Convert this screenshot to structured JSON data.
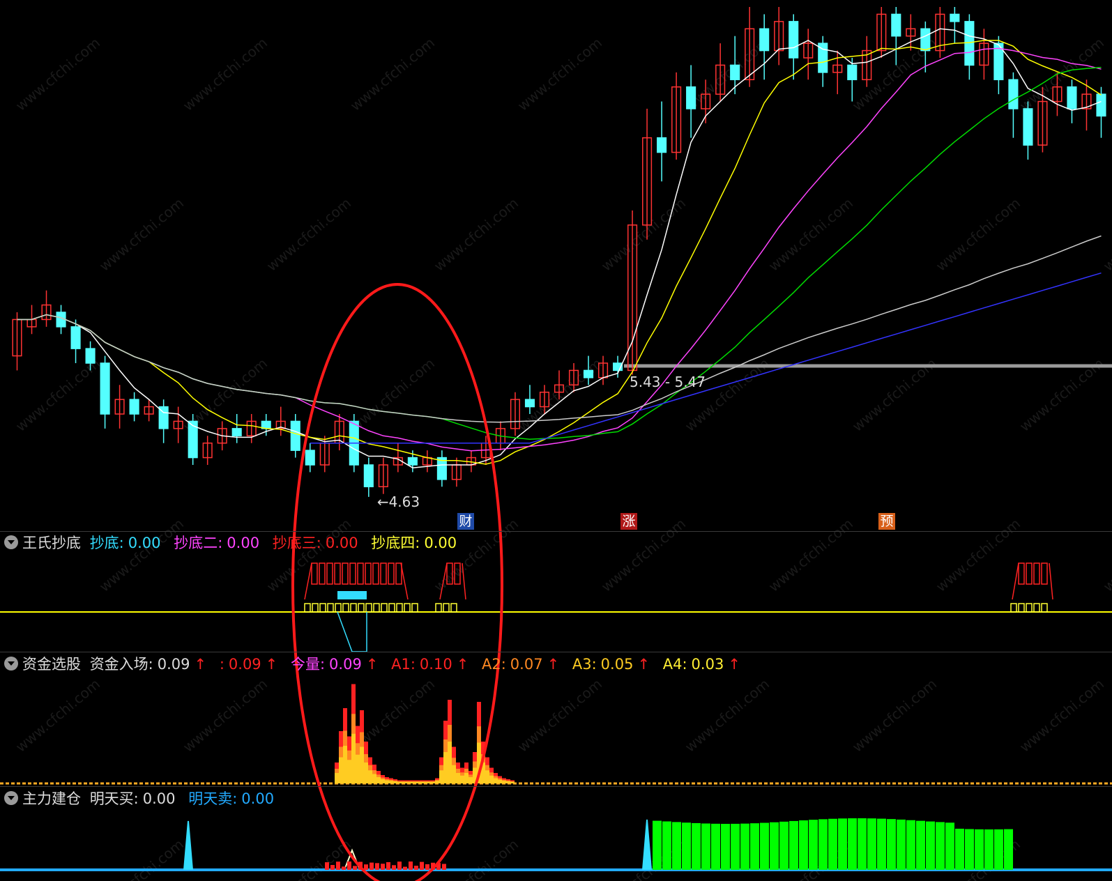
{
  "colors": {
    "background": "#000000",
    "up_candle": "#ff3333",
    "down_candle": "#54ffff",
    "ma5": "#ffffff",
    "ma10": "#ffff00",
    "ma20": "#ff44ff",
    "ma30": "#00dd00",
    "ma60": "#cccccc",
    "ma120": "#3333ff",
    "highlight_ellipse": "#ff1a1a",
    "baseline": "#ffff00",
    "tomorrow_buy": "#00ff00",
    "tomorrow_sell": "#22aaff"
  },
  "watermark": "www.cfchi.com",
  "main_panel": {
    "low_label": "4.63",
    "range_label": "5.43 - 5.47",
    "markers": [
      {
        "text": "财",
        "color": "#1f4aa8"
      },
      {
        "text": "涨",
        "color": "#b01818"
      },
      {
        "text": "预",
        "color": "#d8601a"
      }
    ]
  },
  "panels": {
    "chaodi": {
      "name": "王氏抄底",
      "items": [
        {
          "label": "抄底:",
          "value": "0.00",
          "color": "#33ddff"
        },
        {
          "label": "抄底二:",
          "value": "0.00",
          "color": "#ff44ff"
        },
        {
          "label": "抄底三:",
          "value": "0.00",
          "color": "#ff2222"
        },
        {
          "label": "抄底四:",
          "value": "0.00",
          "color": "#ffff33"
        }
      ]
    },
    "zijin": {
      "name": "资金选股",
      "items": [
        {
          "label": "资金入场:",
          "value": "0.09",
          "arrow": "↑",
          "color": "#dddddd"
        },
        {
          "label": ":",
          "value": "0.09",
          "arrow": "↑",
          "color": "#ff2222"
        },
        {
          "label": "今量:",
          "value": "0.09",
          "arrow": "↑",
          "color": "#ff44ff"
        },
        {
          "label": "A1:",
          "value": "0.10",
          "arrow": "↑",
          "color": "#ff2222"
        },
        {
          "label": "A2:",
          "value": "0.07",
          "arrow": "↑",
          "color": "#ff8822"
        },
        {
          "label": "A3:",
          "value": "0.05",
          "arrow": "↑",
          "color": "#ffcc22"
        },
        {
          "label": "A4:",
          "value": "0.03",
          "arrow": "↑",
          "color": "#ffee33"
        }
      ]
    },
    "zhuli": {
      "name": "主力建仓",
      "items": [
        {
          "label": "明天买:",
          "value": "0.00",
          "color": "#dddddd"
        },
        {
          "label": "明天卖:",
          "value": "0.00",
          "color": "#22aaff"
        }
      ]
    }
  },
  "chart_data": {
    "type": "candlestick",
    "price_range": [
      4.5,
      8.0
    ],
    "candles": [
      [
        5.6,
        5.85,
        5.5,
        5.9
      ],
      [
        5.8,
        5.85,
        5.75,
        5.95
      ],
      [
        5.85,
        5.95,
        5.8,
        6.05
      ],
      [
        5.9,
        5.8,
        5.75,
        5.95
      ],
      [
        5.8,
        5.65,
        5.55,
        5.85
      ],
      [
        5.65,
        5.55,
        5.5,
        5.7
      ],
      [
        5.55,
        5.2,
        5.1,
        5.6
      ],
      [
        5.2,
        5.3,
        5.1,
        5.4
      ],
      [
        5.3,
        5.2,
        5.15,
        5.35
      ],
      [
        5.2,
        5.25,
        5.15,
        5.3
      ],
      [
        5.25,
        5.1,
        5.0,
        5.3
      ],
      [
        5.1,
        5.15,
        5.0,
        5.25
      ],
      [
        5.15,
        4.9,
        4.85,
        5.2
      ],
      [
        4.9,
        5.0,
        4.85,
        5.05
      ],
      [
        5.0,
        5.1,
        4.95,
        5.15
      ],
      [
        5.1,
        5.05,
        5.0,
        5.2
      ],
      [
        5.05,
        5.15,
        5.0,
        5.2
      ],
      [
        5.15,
        5.1,
        5.05,
        5.2
      ],
      [
        5.1,
        5.15,
        5.05,
        5.25
      ],
      [
        5.15,
        4.95,
        4.9,
        5.2
      ],
      [
        4.95,
        4.85,
        4.8,
        5.0
      ],
      [
        4.85,
        5.0,
        4.8,
        5.05
      ],
      [
        5.0,
        5.15,
        4.95,
        5.2
      ],
      [
        5.15,
        4.85,
        4.8,
        5.2
      ],
      [
        4.85,
        4.7,
        4.63,
        4.9
      ],
      [
        4.7,
        4.85,
        4.65,
        4.9
      ],
      [
        4.85,
        4.9,
        4.8,
        5.0
      ],
      [
        4.9,
        4.85,
        4.8,
        4.95
      ],
      [
        4.85,
        4.9,
        4.8,
        4.95
      ],
      [
        4.9,
        4.75,
        4.7,
        4.95
      ],
      [
        4.75,
        4.85,
        4.7,
        4.9
      ],
      [
        4.85,
        4.9,
        4.8,
        4.95
      ],
      [
        4.9,
        5.0,
        4.85,
        5.05
      ],
      [
        5.0,
        5.1,
        4.95,
        5.15
      ],
      [
        5.1,
        5.3,
        5.05,
        5.35
      ],
      [
        5.3,
        5.25,
        5.2,
        5.4
      ],
      [
        5.25,
        5.35,
        5.2,
        5.4
      ],
      [
        5.35,
        5.4,
        5.3,
        5.5
      ],
      [
        5.4,
        5.5,
        5.35,
        5.55
      ],
      [
        5.5,
        5.45,
        5.4,
        5.6
      ],
      [
        5.45,
        5.55,
        5.4,
        5.6
      ],
      [
        5.55,
        5.5,
        5.45,
        5.6
      ],
      [
        5.5,
        6.5,
        5.47,
        6.6
      ],
      [
        6.5,
        7.1,
        6.4,
        7.3
      ],
      [
        7.1,
        7.0,
        6.8,
        7.35
      ],
      [
        7.0,
        7.45,
        6.95,
        7.55
      ],
      [
        7.45,
        7.3,
        7.1,
        7.6
      ],
      [
        7.3,
        7.4,
        7.2,
        7.5
      ],
      [
        7.4,
        7.6,
        7.35,
        7.75
      ],
      [
        7.6,
        7.5,
        7.4,
        7.8
      ],
      [
        7.5,
        7.85,
        7.45,
        8.0
      ],
      [
        7.85,
        7.7,
        7.5,
        7.95
      ],
      [
        7.7,
        7.9,
        7.6,
        8.0
      ],
      [
        7.9,
        7.65,
        7.5,
        7.95
      ],
      [
        7.65,
        7.75,
        7.5,
        7.85
      ],
      [
        7.75,
        7.55,
        7.45,
        7.8
      ],
      [
        7.55,
        7.6,
        7.4,
        7.7
      ],
      [
        7.6,
        7.5,
        7.35,
        7.65
      ],
      [
        7.5,
        7.7,
        7.45,
        7.8
      ],
      [
        7.7,
        7.95,
        7.65,
        8.0
      ],
      [
        7.95,
        7.8,
        7.6,
        8.0
      ],
      [
        7.8,
        7.85,
        7.7,
        7.95
      ],
      [
        7.85,
        7.7,
        7.55,
        7.9
      ],
      [
        7.7,
        7.95,
        7.65,
        8.0
      ],
      [
        7.95,
        7.9,
        7.75,
        8.0
      ],
      [
        7.9,
        7.6,
        7.5,
        7.95
      ],
      [
        7.6,
        7.75,
        7.5,
        7.85
      ],
      [
        7.75,
        7.5,
        7.4,
        7.8
      ],
      [
        7.5,
        7.3,
        7.1,
        7.55
      ],
      [
        7.3,
        7.05,
        6.95,
        7.35
      ],
      [
        7.05,
        7.35,
        7.0,
        7.45
      ],
      [
        7.35,
        7.45,
        7.25,
        7.55
      ],
      [
        7.45,
        7.3,
        7.2,
        7.5
      ],
      [
        7.3,
        7.4,
        7.15,
        7.5
      ],
      [
        7.4,
        7.25,
        7.1,
        7.45
      ]
    ]
  }
}
